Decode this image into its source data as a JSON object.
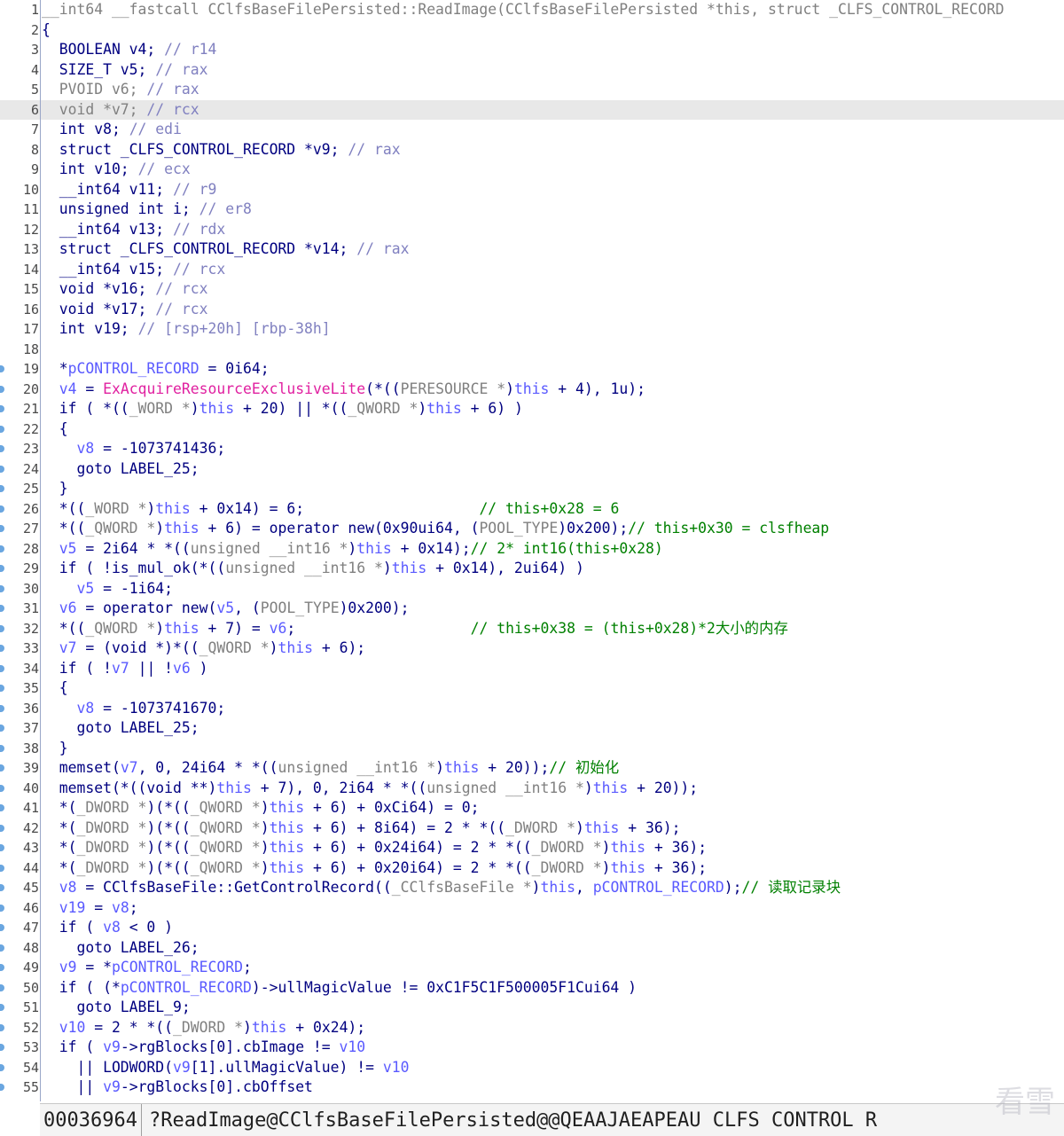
{
  "highlighted_line": 6,
  "lines": [
    {
      "num": "1",
      "segments": [
        {
          "t": "__int64 __fastcall CClfsBaseFilePersisted::ReadImage(CClfsBaseFilePersisted *this, struct _CLFS_CONTROL_RECORD",
          "c": "gray"
        }
      ]
    },
    {
      "num": "2",
      "segments": [
        {
          "t": "{",
          "c": "kw"
        }
      ]
    },
    {
      "num": "3",
      "segments": [
        {
          "t": "  BOOLEAN v4; ",
          "c": "kw"
        },
        {
          "t": "// r14",
          "c": "reg"
        }
      ]
    },
    {
      "num": "4",
      "segments": [
        {
          "t": "  SIZE_T v5; ",
          "c": "kw"
        },
        {
          "t": "// rax",
          "c": "reg"
        }
      ]
    },
    {
      "num": "5",
      "segments": [
        {
          "t": "  PVOID v6; ",
          "c": "gray"
        },
        {
          "t": "// rax",
          "c": "reg"
        }
      ]
    },
    {
      "num": "6",
      "segments": [
        {
          "t": "  void *v7; ",
          "c": "gray"
        },
        {
          "t": "// rcx",
          "c": "reg"
        }
      ]
    },
    {
      "num": "7",
      "segments": [
        {
          "t": "  int v8; ",
          "c": "kw"
        },
        {
          "t": "// edi",
          "c": "reg"
        }
      ]
    },
    {
      "num": "8",
      "segments": [
        {
          "t": "  struct _CLFS_CONTROL_RECORD *v9; ",
          "c": "kw"
        },
        {
          "t": "// rax",
          "c": "reg"
        }
      ]
    },
    {
      "num": "9",
      "segments": [
        {
          "t": "  int v10; ",
          "c": "kw"
        },
        {
          "t": "// ecx",
          "c": "reg"
        }
      ]
    },
    {
      "num": "10",
      "segments": [
        {
          "t": "  __int64 v11; ",
          "c": "kw"
        },
        {
          "t": "// r9",
          "c": "reg"
        }
      ]
    },
    {
      "num": "11",
      "segments": [
        {
          "t": "  unsigned int i; ",
          "c": "kw"
        },
        {
          "t": "// er8",
          "c": "reg"
        }
      ]
    },
    {
      "num": "12",
      "segments": [
        {
          "t": "  __int64 v13; ",
          "c": "kw"
        },
        {
          "t": "// rdx",
          "c": "reg"
        }
      ]
    },
    {
      "num": "13",
      "segments": [
        {
          "t": "  struct _CLFS_CONTROL_RECORD *v14; ",
          "c": "kw"
        },
        {
          "t": "// rax",
          "c": "reg"
        }
      ]
    },
    {
      "num": "14",
      "segments": [
        {
          "t": "  __int64 v15; ",
          "c": "kw"
        },
        {
          "t": "// rcx",
          "c": "reg"
        }
      ]
    },
    {
      "num": "15",
      "segments": [
        {
          "t": "  void *v16; ",
          "c": "kw"
        },
        {
          "t": "// rcx",
          "c": "reg"
        }
      ]
    },
    {
      "num": "16",
      "segments": [
        {
          "t": "  void *v17; ",
          "c": "kw"
        },
        {
          "t": "// rcx",
          "c": "reg"
        }
      ]
    },
    {
      "num": "17",
      "segments": [
        {
          "t": "  int v19; ",
          "c": "kw"
        },
        {
          "t": "// [rsp+20h] [rbp-38h]",
          "c": "reg"
        }
      ]
    },
    {
      "num": "18",
      "segments": []
    },
    {
      "num": "19",
      "segments": [
        {
          "t": "  *",
          "c": "kw"
        },
        {
          "t": "pCONTROL_RECORD",
          "c": "var"
        },
        {
          "t": " = 0i64;",
          "c": "kw"
        }
      ]
    },
    {
      "num": "20",
      "segments": [
        {
          "t": "  ",
          "c": "kw"
        },
        {
          "t": "v4",
          "c": "var"
        },
        {
          "t": " = ",
          "c": "kw"
        },
        {
          "t": "ExAcquireResourceExclusiveLite",
          "c": "pink"
        },
        {
          "t": "(*((",
          "c": "kw"
        },
        {
          "t": "PERESOURCE *",
          "c": "gray"
        },
        {
          "t": ")",
          "c": "kw"
        },
        {
          "t": "this",
          "c": "var"
        },
        {
          "t": " + 4), 1u);",
          "c": "kw"
        }
      ]
    },
    {
      "num": "21",
      "segments": [
        {
          "t": "  if ( *((",
          "c": "kw"
        },
        {
          "t": "_WORD *",
          "c": "gray"
        },
        {
          "t": ")",
          "c": "kw"
        },
        {
          "t": "this",
          "c": "var"
        },
        {
          "t": " + 20) || *((",
          "c": "kw"
        },
        {
          "t": "_QWORD *",
          "c": "gray"
        },
        {
          "t": ")",
          "c": "kw"
        },
        {
          "t": "this",
          "c": "var"
        },
        {
          "t": " + 6) )",
          "c": "kw"
        }
      ]
    },
    {
      "num": "22",
      "segments": [
        {
          "t": "  {",
          "c": "kw"
        }
      ]
    },
    {
      "num": "23",
      "segments": [
        {
          "t": "    ",
          "c": "kw"
        },
        {
          "t": "v8",
          "c": "var"
        },
        {
          "t": " = -1073741436;",
          "c": "kw"
        }
      ]
    },
    {
      "num": "24",
      "segments": [
        {
          "t": "    goto LABEL_25;",
          "c": "kw"
        }
      ]
    },
    {
      "num": "25",
      "segments": [
        {
          "t": "  }",
          "c": "kw"
        }
      ]
    },
    {
      "num": "26",
      "segments": [
        {
          "t": "  *((",
          "c": "kw"
        },
        {
          "t": "_WORD *",
          "c": "gray"
        },
        {
          "t": ")",
          "c": "kw"
        },
        {
          "t": "this",
          "c": "var"
        },
        {
          "t": " + 0x14) = 6;                    ",
          "c": "kw"
        },
        {
          "t": "// this+0x28 = 6",
          "c": "cm"
        }
      ]
    },
    {
      "num": "27",
      "segments": [
        {
          "t": "  *((",
          "c": "kw"
        },
        {
          "t": "_QWORD *",
          "c": "gray"
        },
        {
          "t": ")",
          "c": "kw"
        },
        {
          "t": "this",
          "c": "var"
        },
        {
          "t": " + 6) = operator new(0x90ui64, (",
          "c": "kw"
        },
        {
          "t": "POOL_TYPE",
          "c": "gray"
        },
        {
          "t": ")0x200);",
          "c": "kw"
        },
        {
          "t": "// this+0x30 = clsfheap",
          "c": "cm"
        }
      ]
    },
    {
      "num": "28",
      "segments": [
        {
          "t": "  ",
          "c": "kw"
        },
        {
          "t": "v5",
          "c": "var"
        },
        {
          "t": " = 2i64 * *((",
          "c": "kw"
        },
        {
          "t": "unsigned __int16 *",
          "c": "gray"
        },
        {
          "t": ")",
          "c": "kw"
        },
        {
          "t": "this",
          "c": "var"
        },
        {
          "t": " + 0x14);",
          "c": "kw"
        },
        {
          "t": "// 2* int16(this+0x28)",
          "c": "cm"
        }
      ]
    },
    {
      "num": "29",
      "segments": [
        {
          "t": "  if ( !is_mul_ok(*((",
          "c": "kw"
        },
        {
          "t": "unsigned __int16 *",
          "c": "gray"
        },
        {
          "t": ")",
          "c": "kw"
        },
        {
          "t": "this",
          "c": "var"
        },
        {
          "t": " + 0x14), 2ui64) )",
          "c": "kw"
        }
      ]
    },
    {
      "num": "30",
      "segments": [
        {
          "t": "    ",
          "c": "kw"
        },
        {
          "t": "v5",
          "c": "var"
        },
        {
          "t": " = -1i64;",
          "c": "kw"
        }
      ]
    },
    {
      "num": "31",
      "segments": [
        {
          "t": "  ",
          "c": "kw"
        },
        {
          "t": "v6",
          "c": "var"
        },
        {
          "t": " = operator new(",
          "c": "kw"
        },
        {
          "t": "v5",
          "c": "var"
        },
        {
          "t": ", (",
          "c": "kw"
        },
        {
          "t": "POOL_TYPE",
          "c": "gray"
        },
        {
          "t": ")0x200);",
          "c": "kw"
        }
      ]
    },
    {
      "num": "32",
      "segments": [
        {
          "t": "  *((",
          "c": "kw"
        },
        {
          "t": "_QWORD *",
          "c": "gray"
        },
        {
          "t": ")",
          "c": "kw"
        },
        {
          "t": "this",
          "c": "var"
        },
        {
          "t": " + 7) = ",
          "c": "kw"
        },
        {
          "t": "v6",
          "c": "var"
        },
        {
          "t": ";                    ",
          "c": "kw"
        },
        {
          "t": "// this+0x38 = (this+0x28)*2大小的内存",
          "c": "cm"
        }
      ]
    },
    {
      "num": "33",
      "segments": [
        {
          "t": "  ",
          "c": "kw"
        },
        {
          "t": "v7",
          "c": "var"
        },
        {
          "t": " = (void *)*((",
          "c": "kw"
        },
        {
          "t": "_QWORD *",
          "c": "gray"
        },
        {
          "t": ")",
          "c": "kw"
        },
        {
          "t": "this",
          "c": "var"
        },
        {
          "t": " + 6);",
          "c": "kw"
        }
      ]
    },
    {
      "num": "34",
      "segments": [
        {
          "t": "  if ( !",
          "c": "kw"
        },
        {
          "t": "v7",
          "c": "var"
        },
        {
          "t": " || !",
          "c": "kw"
        },
        {
          "t": "v6",
          "c": "var"
        },
        {
          "t": " )",
          "c": "kw"
        }
      ]
    },
    {
      "num": "35",
      "segments": [
        {
          "t": "  {",
          "c": "kw"
        }
      ]
    },
    {
      "num": "36",
      "segments": [
        {
          "t": "    ",
          "c": "kw"
        },
        {
          "t": "v8",
          "c": "var"
        },
        {
          "t": " = -1073741670;",
          "c": "kw"
        }
      ]
    },
    {
      "num": "37",
      "segments": [
        {
          "t": "    goto LABEL_25;",
          "c": "kw"
        }
      ]
    },
    {
      "num": "38",
      "segments": [
        {
          "t": "  }",
          "c": "kw"
        }
      ]
    },
    {
      "num": "39",
      "segments": [
        {
          "t": "  memset(",
          "c": "kw"
        },
        {
          "t": "v7",
          "c": "var"
        },
        {
          "t": ", 0, 24i64 * *((",
          "c": "kw"
        },
        {
          "t": "unsigned __int16 *",
          "c": "gray"
        },
        {
          "t": ")",
          "c": "kw"
        },
        {
          "t": "this",
          "c": "var"
        },
        {
          "t": " + 20));",
          "c": "kw"
        },
        {
          "t": "// 初始化",
          "c": "cm"
        }
      ]
    },
    {
      "num": "40",
      "segments": [
        {
          "t": "  memset(*((void **)",
          "c": "kw"
        },
        {
          "t": "this",
          "c": "var"
        },
        {
          "t": " + 7), 0, 2i64 * *((",
          "c": "kw"
        },
        {
          "t": "unsigned __int16 *",
          "c": "gray"
        },
        {
          "t": ")",
          "c": "kw"
        },
        {
          "t": "this",
          "c": "var"
        },
        {
          "t": " + 20));",
          "c": "kw"
        }
      ]
    },
    {
      "num": "41",
      "segments": [
        {
          "t": "  *(",
          "c": "kw"
        },
        {
          "t": "_DWORD *",
          "c": "gray"
        },
        {
          "t": ")(*((",
          "c": "kw"
        },
        {
          "t": "_QWORD *",
          "c": "gray"
        },
        {
          "t": ")",
          "c": "kw"
        },
        {
          "t": "this",
          "c": "var"
        },
        {
          "t": " + 6) + 0xCi64) = 0;",
          "c": "kw"
        }
      ]
    },
    {
      "num": "42",
      "segments": [
        {
          "t": "  *(",
          "c": "kw"
        },
        {
          "t": "_DWORD *",
          "c": "gray"
        },
        {
          "t": ")(*((",
          "c": "kw"
        },
        {
          "t": "_QWORD *",
          "c": "gray"
        },
        {
          "t": ")",
          "c": "kw"
        },
        {
          "t": "this",
          "c": "var"
        },
        {
          "t": " + 6) + 8i64) = 2 * *((",
          "c": "kw"
        },
        {
          "t": "_DWORD *",
          "c": "gray"
        },
        {
          "t": ")",
          "c": "kw"
        },
        {
          "t": "this",
          "c": "var"
        },
        {
          "t": " + 36);",
          "c": "kw"
        }
      ]
    },
    {
      "num": "43",
      "segments": [
        {
          "t": "  *(",
          "c": "kw"
        },
        {
          "t": "_DWORD *",
          "c": "gray"
        },
        {
          "t": ")(*((",
          "c": "kw"
        },
        {
          "t": "_QWORD *",
          "c": "gray"
        },
        {
          "t": ")",
          "c": "kw"
        },
        {
          "t": "this",
          "c": "var"
        },
        {
          "t": " + 6) + 0x24i64) = 2 * *((",
          "c": "kw"
        },
        {
          "t": "_DWORD *",
          "c": "gray"
        },
        {
          "t": ")",
          "c": "kw"
        },
        {
          "t": "this",
          "c": "var"
        },
        {
          "t": " + 36);",
          "c": "kw"
        }
      ]
    },
    {
      "num": "44",
      "segments": [
        {
          "t": "  *(",
          "c": "kw"
        },
        {
          "t": "_DWORD *",
          "c": "gray"
        },
        {
          "t": ")(*((",
          "c": "kw"
        },
        {
          "t": "_QWORD *",
          "c": "gray"
        },
        {
          "t": ")",
          "c": "kw"
        },
        {
          "t": "this",
          "c": "var"
        },
        {
          "t": " + 6) + 0x20i64) = 2 * *((",
          "c": "kw"
        },
        {
          "t": "_DWORD *",
          "c": "gray"
        },
        {
          "t": ")",
          "c": "kw"
        },
        {
          "t": "this",
          "c": "var"
        },
        {
          "t": " + 36);",
          "c": "kw"
        }
      ]
    },
    {
      "num": "45",
      "segments": [
        {
          "t": "  ",
          "c": "kw"
        },
        {
          "t": "v8",
          "c": "var"
        },
        {
          "t": " = CClfsBaseFile::GetControlRecord((",
          "c": "kw"
        },
        {
          "t": "_CClfsBaseFile *",
          "c": "gray"
        },
        {
          "t": ")",
          "c": "kw"
        },
        {
          "t": "this",
          "c": "var"
        },
        {
          "t": ", ",
          "c": "kw"
        },
        {
          "t": "pCONTROL_RECORD",
          "c": "var"
        },
        {
          "t": ");",
          "c": "kw"
        },
        {
          "t": "// 读取记录块",
          "c": "cm"
        }
      ]
    },
    {
      "num": "46",
      "segments": [
        {
          "t": "  ",
          "c": "kw"
        },
        {
          "t": "v19",
          "c": "var"
        },
        {
          "t": " = ",
          "c": "kw"
        },
        {
          "t": "v8",
          "c": "var"
        },
        {
          "t": ";",
          "c": "kw"
        }
      ]
    },
    {
      "num": "47",
      "segments": [
        {
          "t": "  if ( ",
          "c": "kw"
        },
        {
          "t": "v8",
          "c": "var"
        },
        {
          "t": " < 0 )",
          "c": "kw"
        }
      ]
    },
    {
      "num": "48",
      "segments": [
        {
          "t": "    goto LABEL_26;",
          "c": "kw"
        }
      ]
    },
    {
      "num": "49",
      "segments": [
        {
          "t": "  ",
          "c": "kw"
        },
        {
          "t": "v9",
          "c": "var"
        },
        {
          "t": " = *",
          "c": "kw"
        },
        {
          "t": "pCONTROL_RECORD",
          "c": "var"
        },
        {
          "t": ";",
          "c": "kw"
        }
      ]
    },
    {
      "num": "50",
      "segments": [
        {
          "t": "  if ( (*",
          "c": "kw"
        },
        {
          "t": "pCONTROL_RECORD",
          "c": "var"
        },
        {
          "t": ")->ullMagicValue != 0xC1F5C1F500005F1Cui64 )",
          "c": "kw"
        }
      ]
    },
    {
      "num": "51",
      "segments": [
        {
          "t": "    goto LABEL_9;",
          "c": "kw"
        }
      ]
    },
    {
      "num": "52",
      "segments": [
        {
          "t": "  ",
          "c": "kw"
        },
        {
          "t": "v10",
          "c": "var"
        },
        {
          "t": " = 2 * *((",
          "c": "kw"
        },
        {
          "t": "_DWORD *",
          "c": "gray"
        },
        {
          "t": ")",
          "c": "kw"
        },
        {
          "t": "this",
          "c": "var"
        },
        {
          "t": " + 0x24);",
          "c": "kw"
        }
      ]
    },
    {
      "num": "53",
      "segments": [
        {
          "t": "  if ( ",
          "c": "kw"
        },
        {
          "t": "v9",
          "c": "var"
        },
        {
          "t": "->rgBlocks[0].cbImage != ",
          "c": "kw"
        },
        {
          "t": "v10",
          "c": "var"
        }
      ]
    },
    {
      "num": "54",
      "segments": [
        {
          "t": "    || LODWORD(",
          "c": "kw"
        },
        {
          "t": "v9",
          "c": "var"
        },
        {
          "t": "[1].ullMagicValue) != ",
          "c": "kw"
        },
        {
          "t": "v10",
          "c": "var"
        }
      ]
    },
    {
      "num": "55",
      "segments": [
        {
          "t": "    || ",
          "c": "kw"
        },
        {
          "t": "v9",
          "c": "var"
        },
        {
          "t": "->rgBlocks[0].cbOffset",
          "c": "kw"
        }
      ]
    }
  ],
  "status_bar": {
    "address": "00036964",
    "symbol": "?ReadImage@CClfsBaseFilePersisted@@QEAAJAEAPEAU CLFS CONTROL R"
  },
  "watermark": "看雪",
  "colors": {
    "keyword": "#000080",
    "comment": "#008000",
    "register": "#8080c0",
    "type_gray": "#808080",
    "api_pink": "#e020a0",
    "variable": "#5a5aff",
    "highlight": "#e8e8e8"
  }
}
